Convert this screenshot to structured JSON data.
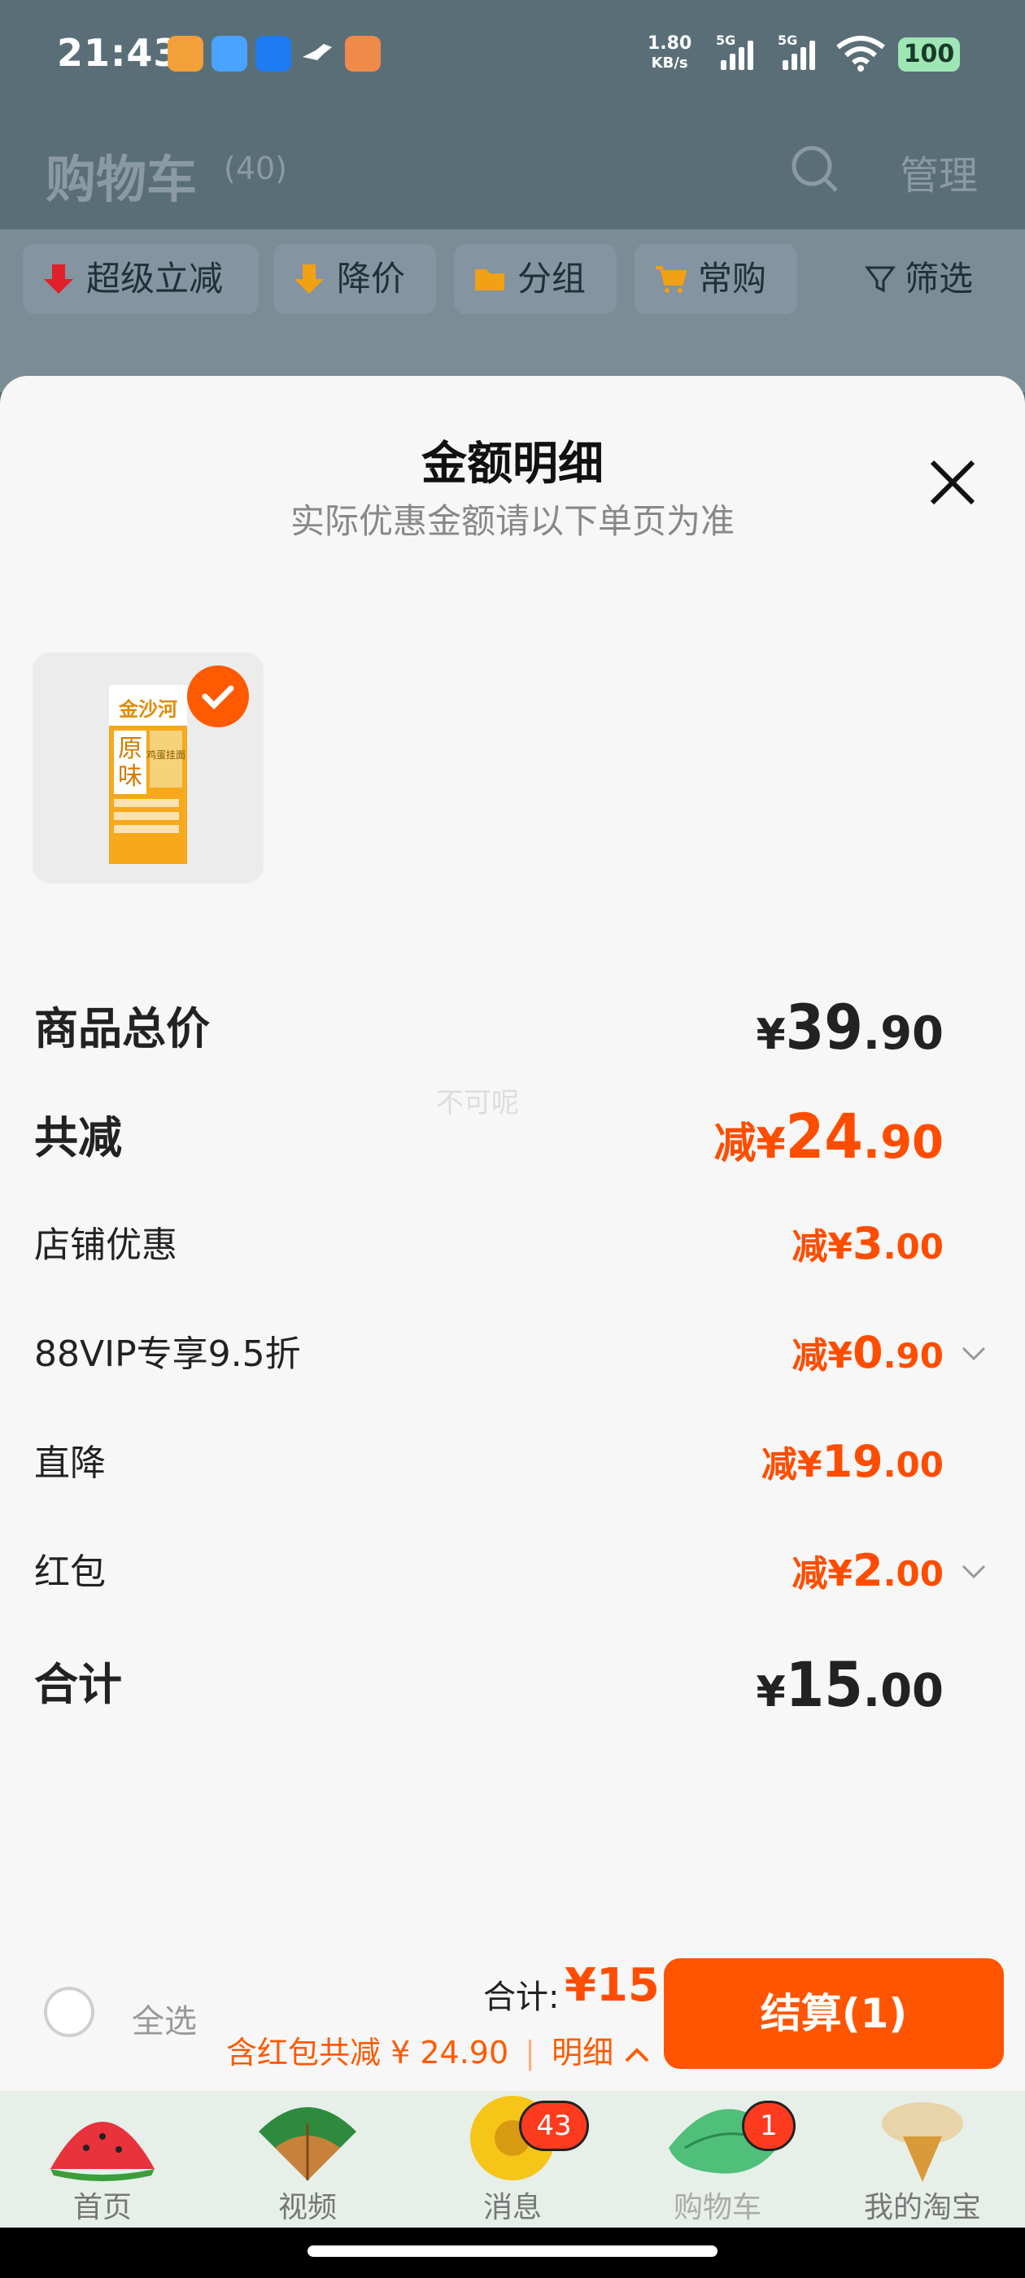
{
  "status_bar": {
    "time": "21:43",
    "net_speed_value": "1.80",
    "net_speed_unit": "KB/s",
    "signal_label_1": "5G",
    "signal_label_2": "5G",
    "battery": "100"
  },
  "header": {
    "title": "购物车",
    "count": "(40)",
    "manage": "管理"
  },
  "filters": [
    {
      "label": "超级立减",
      "icon": "down-arrow-red-icon"
    },
    {
      "label": "降价",
      "icon": "down-arrow-orange-icon"
    },
    {
      "label": "分组",
      "icon": "folder-icon"
    },
    {
      "label": "常购",
      "icon": "cart-icon"
    },
    {
      "label": "筛选",
      "icon": "filter-icon"
    }
  ],
  "sheet": {
    "title": "金额明细",
    "subtitle": "实际优惠金额请以下单页为准",
    "product_brand": "金沙河",
    "product_flavor_1": "原",
    "product_flavor_2": "味",
    "product_type": "鸡蛋挂面",
    "rows": [
      {
        "label": "商品总价",
        "prefix": "",
        "yen": "¥",
        "int": "39",
        "dec": ".90"
      },
      {
        "label": "共减",
        "prefix": "减",
        "yen": "¥",
        "int": "24",
        "dec": ".90"
      },
      {
        "label": "店铺优惠",
        "prefix": "减",
        "yen": "¥",
        "int": "3",
        "dec": ".00"
      },
      {
        "label": "88VIP专享9.5折",
        "prefix": "减",
        "yen": "¥",
        "int": "0",
        "dec": ".90"
      },
      {
        "label": "直降",
        "prefix": "减",
        "yen": "¥",
        "int": "19",
        "dec": ".00"
      },
      {
        "label": "红包",
        "prefix": "减",
        "yen": "¥",
        "int": "2",
        "dec": ".00"
      },
      {
        "label": "合计",
        "prefix": "",
        "yen": "¥",
        "int": "15",
        "dec": ".00"
      }
    ],
    "watermark": "不可呢"
  },
  "bottom_bar": {
    "select_all": "全选",
    "total_label": "合计:",
    "total_value": "¥15",
    "discount_summary": "含红包共减 ¥ 24.90",
    "detail_link": "明细",
    "checkout": "结算(1)"
  },
  "tabs": [
    {
      "label": "首页",
      "icon": "watermelon-icon"
    },
    {
      "label": "视频",
      "icon": "fan-icon"
    },
    {
      "label": "消息",
      "icon": "sunflower-icon",
      "badge": "43"
    },
    {
      "label": "购物车",
      "icon": "leaf-hat-icon",
      "badge": "1"
    },
    {
      "label": "我的淘宝",
      "icon": "ice-cream-icon"
    }
  ],
  "colors": {
    "accent": "#ff5500",
    "discount": "#ff4d00",
    "overlay": "#5a6e78"
  }
}
